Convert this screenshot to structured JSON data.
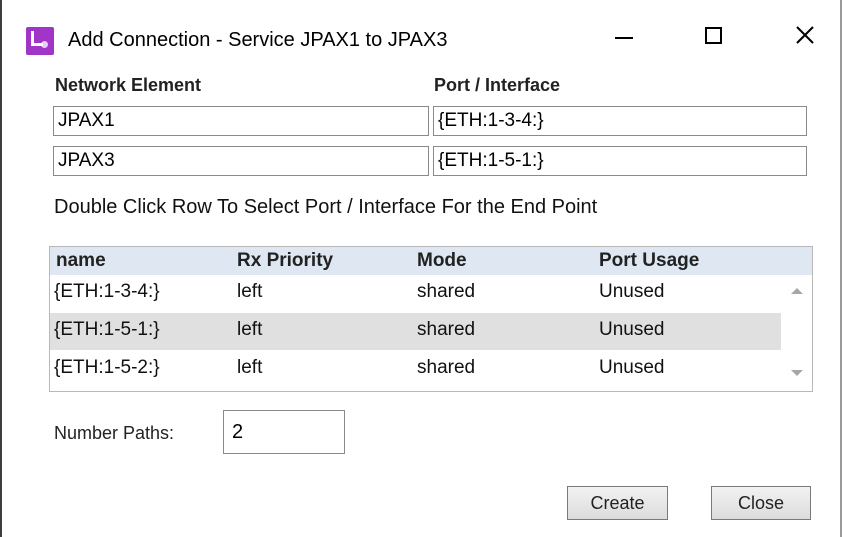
{
  "window": {
    "title": "Add Connection - Service JPAX1 to JPAX3",
    "icon": "app-icon",
    "accent_color": "#a035c8"
  },
  "form": {
    "network_element_label": "Network Element",
    "port_interface_label": "Port / Interface",
    "rows": [
      {
        "network_element": "JPAX1",
        "port_interface": "{ETH:1-3-4:}"
      },
      {
        "network_element": "JPAX3",
        "port_interface": "{ETH:1-5-1:}"
      }
    ],
    "hint": "Double Click Row To Select Port / Interface For the End Point"
  },
  "table": {
    "columns": [
      "name",
      "Rx Priority",
      "Mode",
      "Port Usage"
    ],
    "rows": [
      {
        "name": "{ETH:1-3-4:}",
        "rx_priority": "left",
        "mode": "shared",
        "port_usage": "Unused",
        "selected": false
      },
      {
        "name": "{ETH:1-5-1:}",
        "rx_priority": "left",
        "mode": "shared",
        "port_usage": "Unused",
        "selected": true
      },
      {
        "name": "{ETH:1-5-2:}",
        "rx_priority": "left",
        "mode": "shared",
        "port_usage": "Unused",
        "selected": false
      }
    ],
    "header_color": "#dee7f2",
    "selected_row_color": "#e0e0e0"
  },
  "number_paths": {
    "label": "Number Paths:",
    "value": "2"
  },
  "buttons": {
    "create": "Create",
    "close": "Close"
  }
}
